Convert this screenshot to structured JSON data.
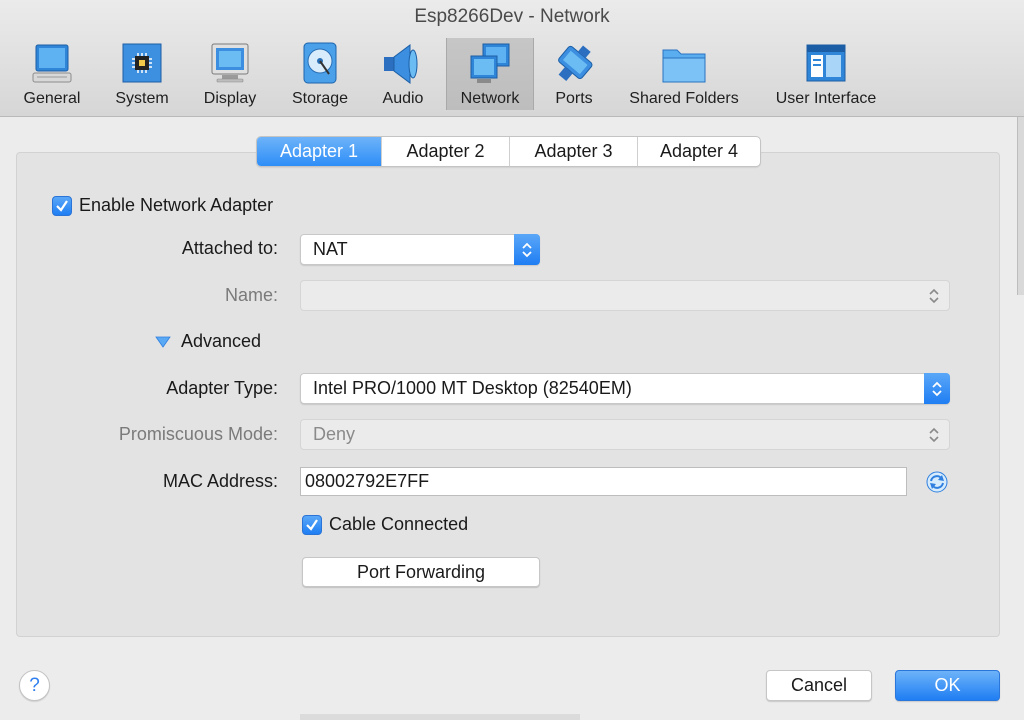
{
  "window": {
    "title": "Esp8266Dev - Network"
  },
  "toolbar": {
    "items": [
      {
        "label": "General",
        "icon": "general-icon"
      },
      {
        "label": "System",
        "icon": "system-icon"
      },
      {
        "label": "Display",
        "icon": "display-icon"
      },
      {
        "label": "Storage",
        "icon": "storage-icon"
      },
      {
        "label": "Audio",
        "icon": "audio-icon"
      },
      {
        "label": "Network",
        "icon": "network-icon",
        "active": true
      },
      {
        "label": "Ports",
        "icon": "ports-icon"
      },
      {
        "label": "Shared Folders",
        "icon": "shared-folders-icon"
      },
      {
        "label": "User Interface",
        "icon": "user-interface-icon"
      }
    ]
  },
  "tabs": [
    {
      "label": "Adapter 1",
      "active": true
    },
    {
      "label": "Adapter 2"
    },
    {
      "label": "Adapter 3"
    },
    {
      "label": "Adapter 4"
    }
  ],
  "form": {
    "enable_adapter": {
      "label": "Enable Network Adapter",
      "checked": true
    },
    "attached_to": {
      "label": "Attached to:",
      "value": "NAT"
    },
    "name": {
      "label": "Name:",
      "value": ""
    },
    "advanced": {
      "label": "Advanced",
      "expanded": true
    },
    "adapter_type": {
      "label": "Adapter Type:",
      "value": "Intel PRO/1000 MT Desktop (82540EM)"
    },
    "promiscuous_mode": {
      "label": "Promiscuous Mode:",
      "value": "Deny"
    },
    "mac_address": {
      "label": "MAC Address:",
      "value": "08002792E7FF"
    },
    "cable_connected": {
      "label": "Cable Connected",
      "checked": true
    },
    "port_forwarding": {
      "label": "Port Forwarding"
    }
  },
  "footer": {
    "help_label": "?",
    "cancel_label": "Cancel",
    "ok_label": "OK"
  },
  "colors": {
    "accent": "#2e8ef7",
    "window_bg": "#ececec",
    "group_bg": "#e3e3e3"
  }
}
